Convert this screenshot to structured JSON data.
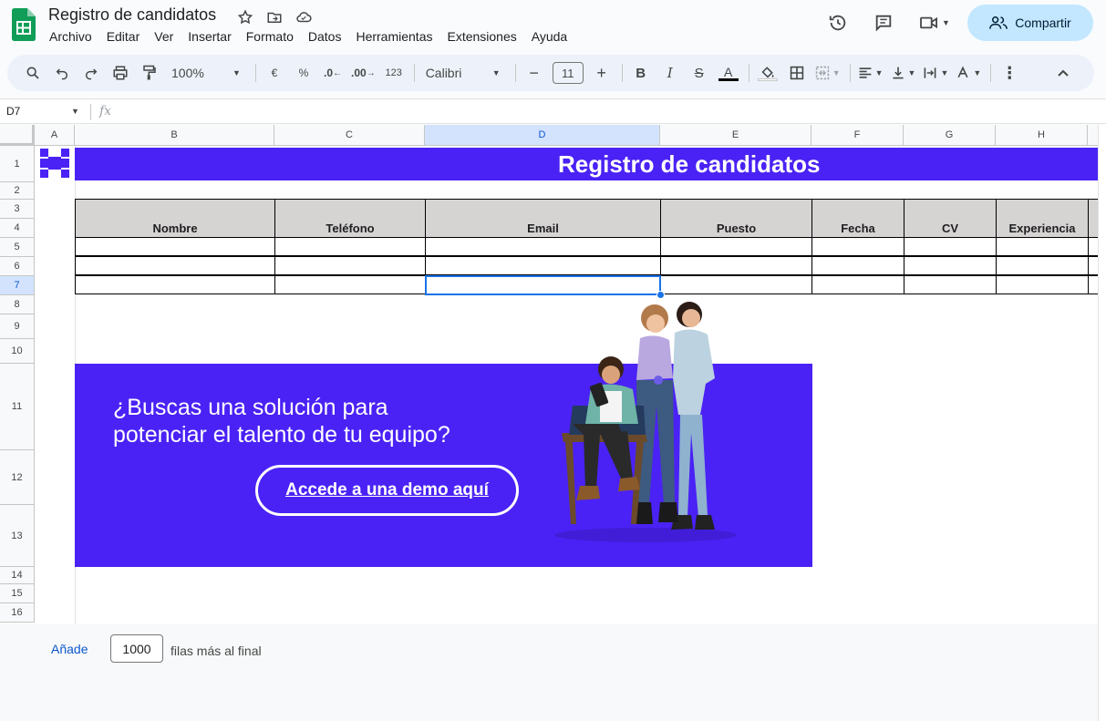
{
  "app": {
    "doc_title": "Registro de candidatos",
    "menu": [
      "Archivo",
      "Editar",
      "Ver",
      "Insertar",
      "Formato",
      "Datos",
      "Herramientas",
      "Extensiones",
      "Ayuda"
    ],
    "share_label": "Compartir"
  },
  "toolbar": {
    "zoom": "100%",
    "currency": "€",
    "percent": "%",
    "dec_decrease": ".0",
    "dec_increase": ".00",
    "number_format": "123",
    "font": "Calibri",
    "font_size": "11",
    "bold": "B",
    "italic": "I",
    "strike": "S",
    "text_color": "A"
  },
  "formula_bar": {
    "name_box": "D7",
    "fx": "fx"
  },
  "grid": {
    "columns": [
      "A",
      "B",
      "C",
      "D",
      "E",
      "F",
      "G",
      "H"
    ],
    "selected_column": "D",
    "rows": [
      "1",
      "2",
      "3",
      "4",
      "5",
      "6",
      "7",
      "8",
      "9",
      "10",
      "11",
      "12",
      "13",
      "14",
      "15",
      "16"
    ],
    "selected_row": "7"
  },
  "sheet": {
    "banner_title": "Registro de candidatos",
    "table_headers": [
      "Nombre",
      "Teléfono",
      "Email",
      "Puesto",
      "Fecha",
      "CV",
      "Experiencia"
    ],
    "promo": {
      "line1": "¿Buscas una solución para",
      "line2": "potenciar el talento de tu equipo?",
      "button": "Accede a una demo aquí"
    }
  },
  "footer": {
    "add_label": "Añade",
    "rows_value": "1000",
    "rows_suffix": "filas más al final"
  },
  "colors": {
    "brand_purple": "#4a22f5",
    "share_bg": "#c2e7ff",
    "selection_blue": "#1a73e8"
  }
}
